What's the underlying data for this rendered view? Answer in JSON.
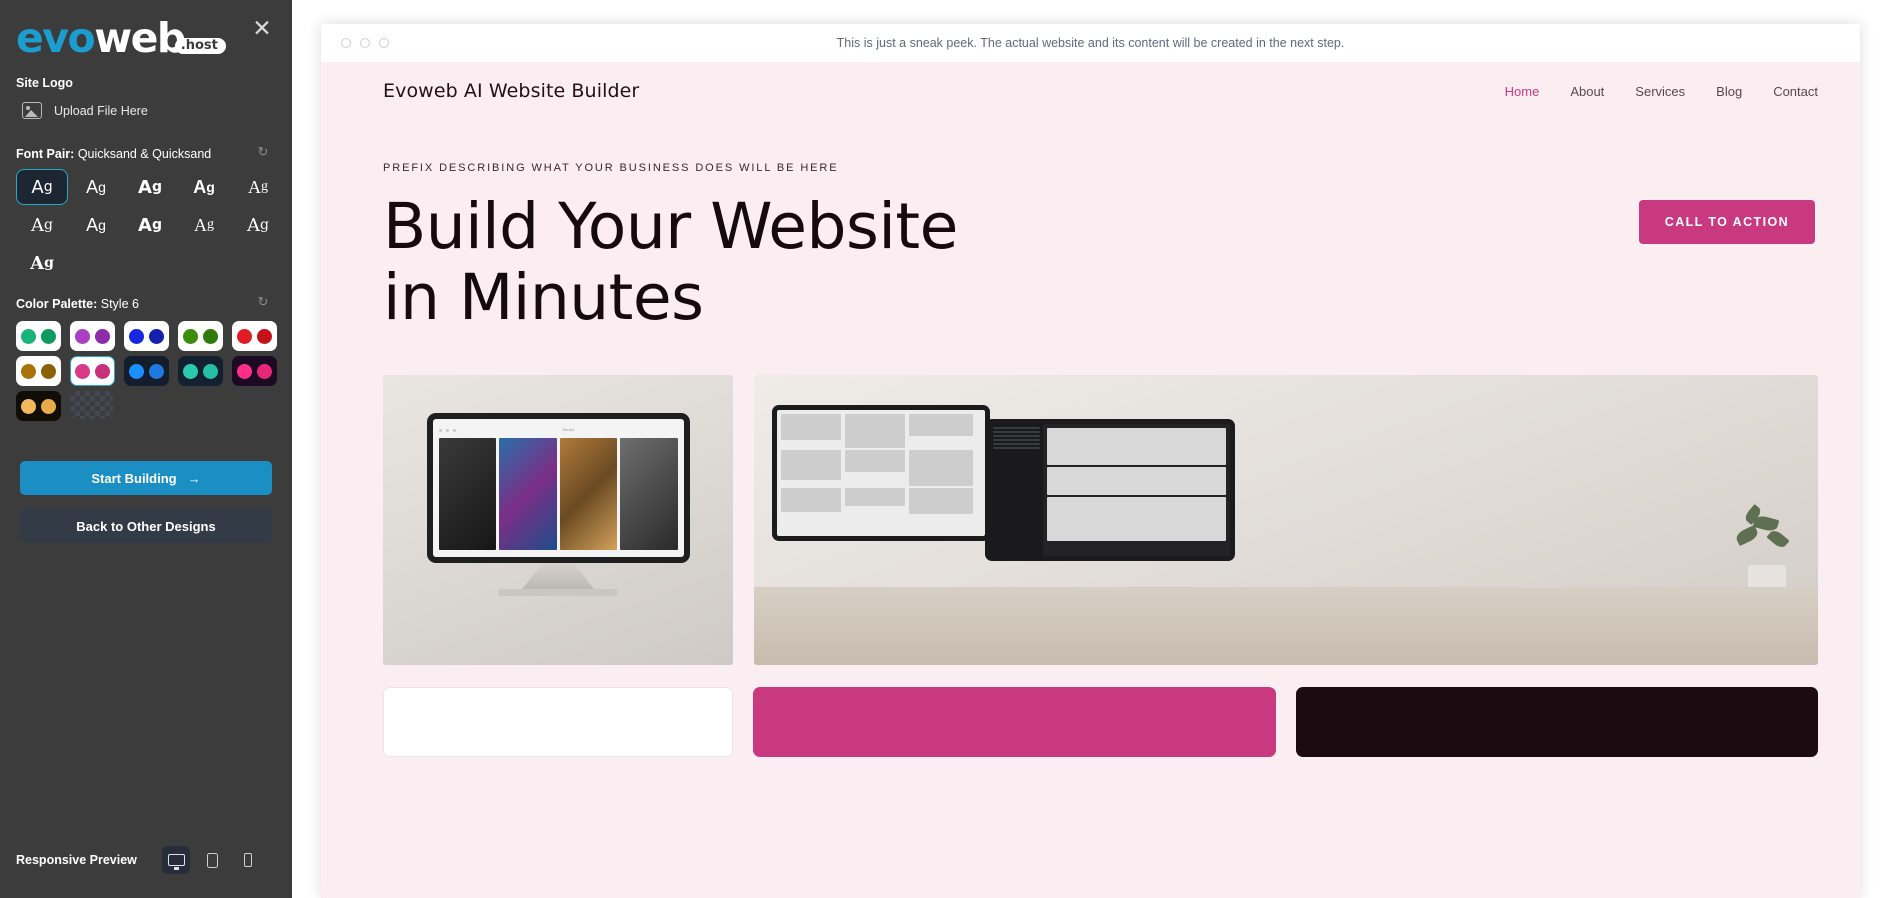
{
  "sidebar": {
    "logo": {
      "part1": "evo",
      "part2": "web",
      "badge": ".host"
    },
    "close_icon": "close-icon",
    "site_logo": {
      "label": "Site Logo",
      "upload_label": "Upload File Here"
    },
    "font_pair": {
      "label": "Font Pair:",
      "value": "Quicksand & Quicksand",
      "refresh_icon": "refresh-icon",
      "sample_text": "Ag",
      "options": [
        {
          "name": "font-option-1",
          "selected": true
        },
        {
          "name": "font-option-2",
          "selected": false
        },
        {
          "name": "font-option-3",
          "selected": false
        },
        {
          "name": "font-option-4",
          "selected": false
        },
        {
          "name": "font-option-5",
          "selected": false
        },
        {
          "name": "font-option-6",
          "selected": false
        },
        {
          "name": "font-option-7",
          "selected": false
        },
        {
          "name": "font-option-8",
          "selected": false
        },
        {
          "name": "font-option-9",
          "selected": false
        },
        {
          "name": "font-option-10",
          "selected": false
        },
        {
          "name": "font-option-11",
          "selected": false
        }
      ]
    },
    "color_palette": {
      "label": "Color Palette:",
      "value": "Style 6",
      "refresh_icon": "refresh-icon",
      "options": [
        {
          "bg": "#ffffff",
          "dot1": "#19b37a",
          "dot2": "#0f9a5f",
          "selected": false
        },
        {
          "bg": "#ffffff",
          "dot1": "#ab3fc4",
          "dot2": "#8f2ba8",
          "selected": false
        },
        {
          "bg": "#ffffff",
          "dot1": "#1528e0",
          "dot2": "#1520b0",
          "selected": false
        },
        {
          "bg": "#ffffff",
          "dot1": "#3d8d0d",
          "dot2": "#2f7a09",
          "selected": false
        },
        {
          "bg": "#ffffff",
          "dot1": "#e01b24",
          "dot2": "#c41219",
          "selected": false
        },
        {
          "bg": "#ffffff",
          "dot1": "#a87408",
          "dot2": "#8a6206",
          "selected": false
        },
        {
          "bg": "#ffffff",
          "dot1": "#d93a85",
          "dot2": "#c9307a",
          "selected": true
        },
        {
          "bg": "#141d2b",
          "dot1": "#1a8fff",
          "dot2": "#1f7ae0",
          "selected": false
        },
        {
          "bg": "#122030",
          "dot1": "#2ac9b0",
          "dot2": "#25bda4",
          "selected": false
        },
        {
          "bg": "#1b0a22",
          "dot1": "#ff2e87",
          "dot2": "#e62678",
          "selected": false
        },
        {
          "bg": "#100d06",
          "dot1": "#f2b85c",
          "dot2": "#e8ab4a",
          "selected": false
        },
        {
          "bg": "transparent",
          "dot1": "",
          "dot2": "",
          "selected": false,
          "checker": true
        }
      ]
    },
    "start_button": "Start Building",
    "start_button_icon": "arrow-right-icon",
    "back_button": "Back to Other Designs",
    "responsive_preview": {
      "label": "Responsive Preview",
      "devices": [
        {
          "name": "desktop-preview-button",
          "icon": "monitor-icon",
          "selected": true
        },
        {
          "name": "tablet-preview-button",
          "icon": "tablet-icon",
          "selected": false
        },
        {
          "name": "mobile-preview-button",
          "icon": "phone-icon",
          "selected": false
        }
      ]
    }
  },
  "collapse_handle_icon": "chevron-left-icon",
  "browser": {
    "sneak_text": "This is just a sneak peek. The actual website and its content will be created in the next step."
  },
  "site": {
    "brand": "Evoweb AI Website Builder",
    "nav": [
      {
        "label": "Home",
        "active": true
      },
      {
        "label": "About",
        "active": false
      },
      {
        "label": "Services",
        "active": false
      },
      {
        "label": "Blog",
        "active": false
      },
      {
        "label": "Contact",
        "active": false
      }
    ],
    "hero": {
      "prefix": "PREFIX DESCRIBING WHAT YOUR BUSINESS DOES WILL BE HERE",
      "title": "Build Your Website in Minutes",
      "cta": "CALL TO ACTION"
    },
    "imac_mock": {
      "title": "Studio"
    },
    "colors": {
      "accent": "#c9397f",
      "background": "#fbeef3",
      "dark": "#1d0b12"
    }
  }
}
